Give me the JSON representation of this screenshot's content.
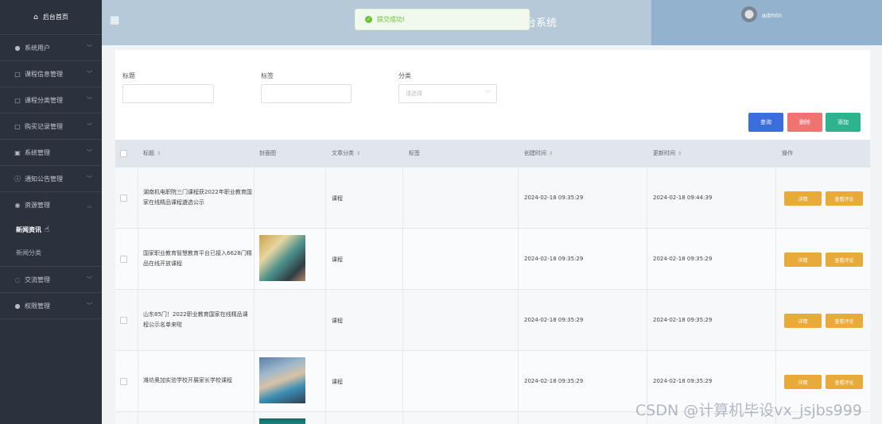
{
  "sidebar": {
    "home": "后台首页",
    "items": [
      {
        "label": "系统用户",
        "icon": "user-icon"
      },
      {
        "label": "课程信息管理",
        "icon": "folder-icon"
      },
      {
        "label": "课程分类管理",
        "icon": "folder-icon"
      },
      {
        "label": "购买记录管理",
        "icon": "folder-icon"
      },
      {
        "label": "系统管理",
        "icon": "image-icon"
      },
      {
        "label": "通知公告管理",
        "icon": "info-icon"
      },
      {
        "label": "资源管理",
        "icon": "location-icon"
      },
      {
        "label": "交流管理",
        "icon": "chat-icon"
      },
      {
        "label": "权限管理",
        "icon": "user-icon"
      }
    ],
    "sub_items": [
      "新闻资讯",
      "新闻分类"
    ]
  },
  "topbar": {
    "title": "台系统",
    "username": "admin"
  },
  "toast": {
    "message": "提交成功!"
  },
  "filters": {
    "title_label": "标题",
    "tag_label": "标签",
    "category_label": "分类",
    "category_placeholder": "请选择"
  },
  "buttons": {
    "query": "查询",
    "delete": "删除",
    "add": "添加"
  },
  "table": {
    "columns": [
      "标题",
      "封面图",
      "文章分类",
      "标签",
      "创建时间",
      "更新时间",
      "操作"
    ],
    "action_detail": "详情",
    "action_review": "查看评论",
    "rows": [
      {
        "title": "湖南机电职院三门课程获2022年职业教育国家在线精品课程遴选公示",
        "category": "课程",
        "tag": "",
        "created": "2024-02-18 09:35:29",
        "updated": "2024-02-18 09:44:39"
      },
      {
        "title": "国家职业教育智慧教育平台已接入6628门精品在线开放课程",
        "category": "课程",
        "tag": "",
        "created": "2024-02-18 09:35:29",
        "updated": "2024-02-18 09:35:29"
      },
      {
        "title": "山东85门！2022职业教育国家在线精品课程公示名单来啦",
        "category": "课程",
        "tag": "",
        "created": "2024-02-18 09:35:29",
        "updated": "2024-02-18 09:35:29"
      },
      {
        "title": "潍坊奥加实验学校开展家长学校课程",
        "category": "课程",
        "tag": "",
        "created": "2024-02-18 09:35:29",
        "updated": "2024-02-18 09:35:29"
      }
    ]
  },
  "watermark": "CSDN @计算机毕设vx_jsjbs999"
}
